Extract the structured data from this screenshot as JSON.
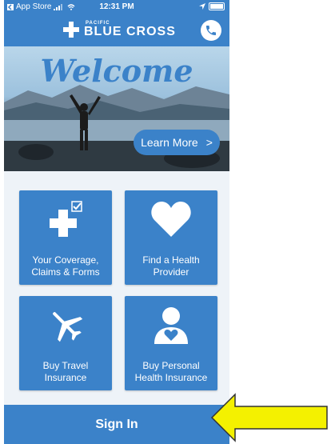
{
  "status_bar": {
    "back_label": "App Store",
    "time": "12:31 PM"
  },
  "header": {
    "logo_small": "PACIFIC",
    "logo_main": "BLUE CROSS"
  },
  "hero": {
    "welcome": "Welcome",
    "learn_more": "Learn More",
    "learn_more_chevron": ">"
  },
  "tiles": [
    {
      "label_line1": "Your Coverage,",
      "label_line2": "Claims & Forms"
    },
    {
      "label_line1": "Find a Health",
      "label_line2": "Provider"
    },
    {
      "label_line1": "Buy Travel",
      "label_line2": "Insurance"
    },
    {
      "label_line1": "Buy Personal",
      "label_line2": "Health Insurance"
    }
  ],
  "sign_in": "Sign In",
  "colors": {
    "brand_blue": "#3b82c9",
    "annotation_arrow": "#f4f100"
  },
  "icons": {
    "phone": "phone-icon",
    "coverage": "medical-cross-check-icon",
    "provider": "heart-icon",
    "travel": "airplane-icon",
    "personal": "person-heart-icon"
  }
}
